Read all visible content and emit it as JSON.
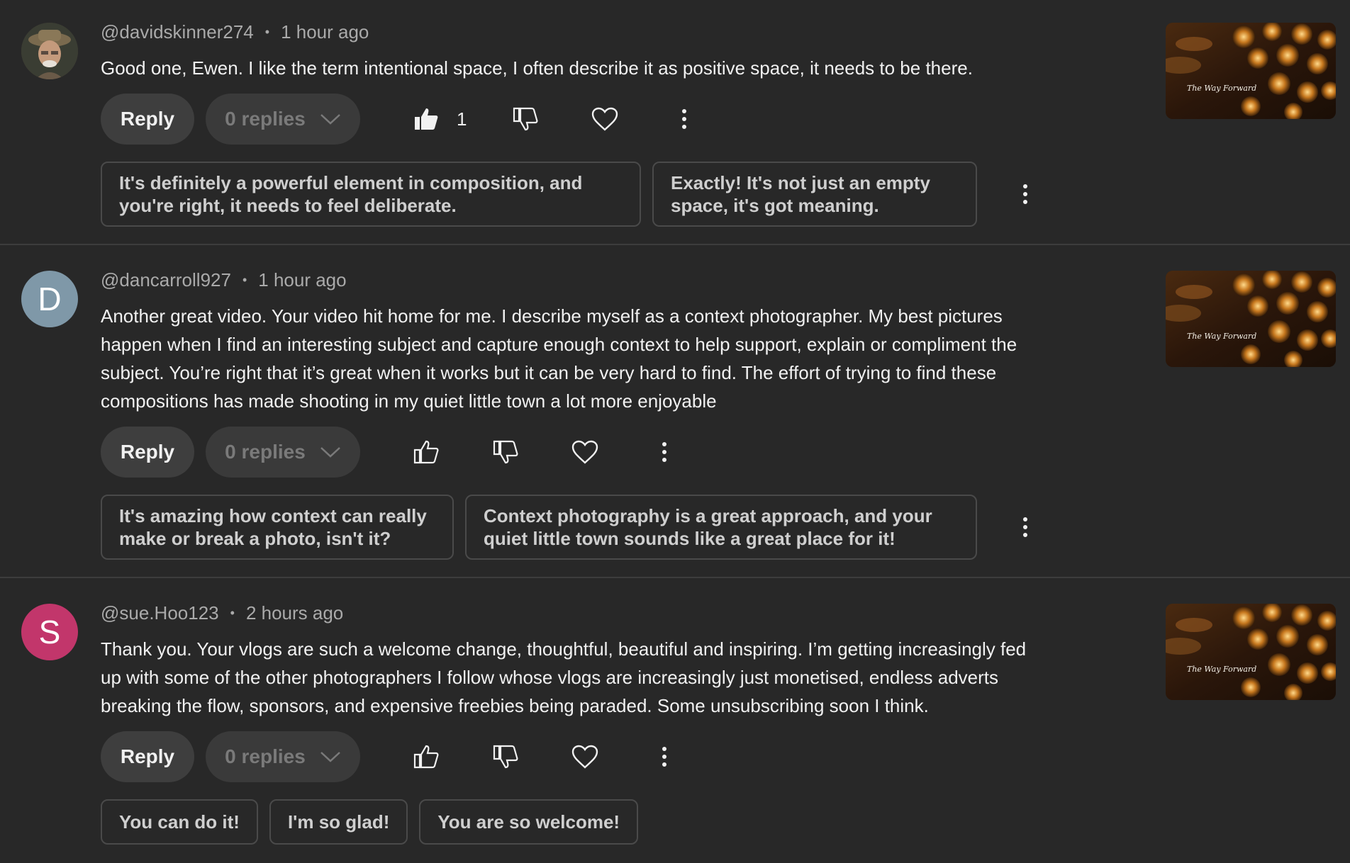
{
  "comments": [
    {
      "username": "@davidskinner274",
      "separator": "•",
      "time": "1 hour ago",
      "avatar_letter": "",
      "avatar_type": "photo",
      "text": "Good one, Ewen. I like the term intentional space, I often describe it as positive space, it needs to be there.",
      "reply_label": "Reply",
      "replies_label": "0 replies",
      "like_count": "1",
      "liked": true,
      "suggestions": [
        "It's definitely a powerful element in composition, and you're right, it needs to feel deliberate.",
        "Exactly! It's not just an empty space, it's got meaning."
      ],
      "thumbnail_caption": "The Way Forward"
    },
    {
      "username": "@dancarroll927",
      "separator": "•",
      "time": "1 hour ago",
      "avatar_letter": "D",
      "avatar_color": "#7f98a8",
      "text": "Another great video.  Your video hit home for me.  I describe myself as a context photographer.  My best pictures happen when I find an interesting subject and capture enough context to help support, explain or compliment the subject.  You’re right that it’s great when it works but it can be very hard to find.  The effort of trying to find these compositions has made shooting in my quiet little town a lot more enjoyable",
      "reply_label": "Reply",
      "replies_label": "0 replies",
      "like_count": "",
      "liked": false,
      "suggestions": [
        "It's amazing how context can really make or break a photo, isn't it?",
        "Context photography is a great approach, and your quiet little town sounds like a great place for it!"
      ],
      "thumbnail_caption": "The Way Forward"
    },
    {
      "username": "@sue.Hoo123",
      "separator": "•",
      "time": "2 hours ago",
      "avatar_letter": "S",
      "avatar_color": "#c2366b",
      "text": "Thank you.  Your vlogs are such a welcome change, thoughtful, beautiful and inspiring.  I’m getting increasingly fed up with some of the other photographers I follow whose vlogs are increasingly just monetised, endless adverts breaking the flow, sponsors, and expensive freebies being paraded.  Some unsubscribing soon I think.",
      "reply_label": "Reply",
      "replies_label": "0 replies",
      "like_count": "",
      "liked": false,
      "suggestions": [
        "You can do it!",
        "I'm so glad!",
        "You are so welcome!"
      ],
      "thumbnail_caption": "The Way Forward"
    }
  ],
  "icons": {
    "like": "thumb-up-icon",
    "dislike": "thumb-down-icon",
    "heart": "heart-icon",
    "more": "more-vertical-icon",
    "chevron": "chevron-down-icon"
  },
  "colors": {
    "background": "#282828",
    "chip_border": "#4a4a4a",
    "button_bg": "#3e3e3e"
  }
}
